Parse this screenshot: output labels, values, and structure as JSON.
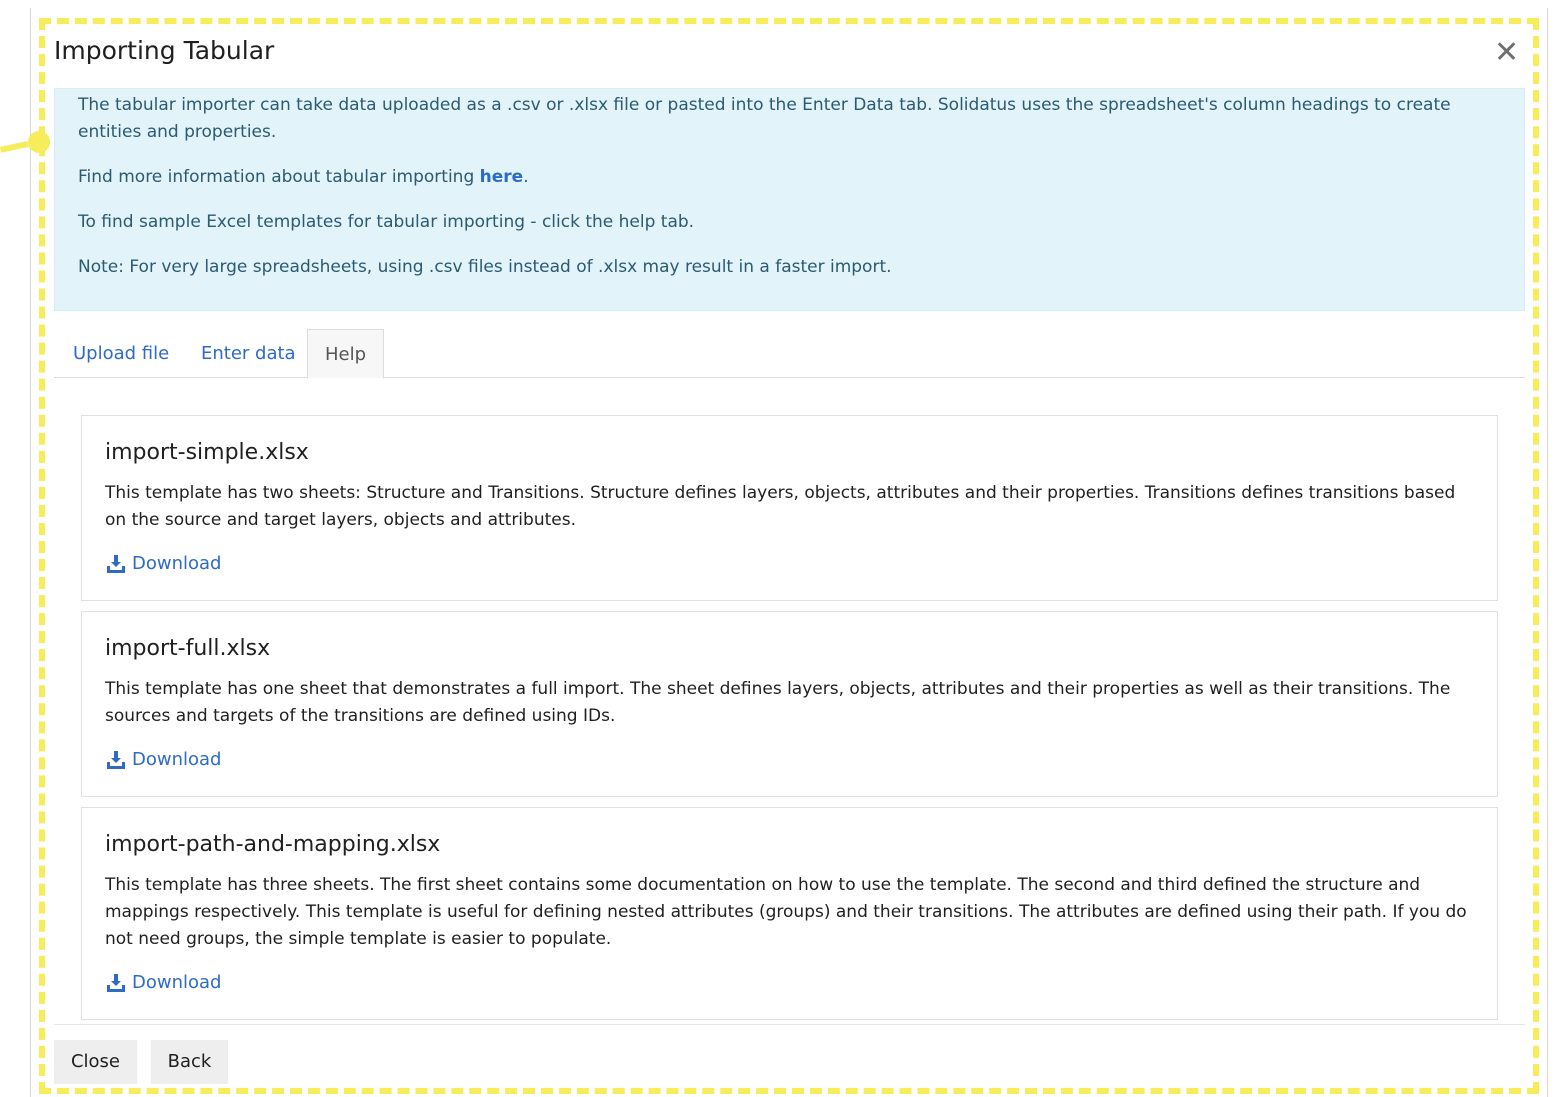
{
  "dialog": {
    "title": "Importing Tabular",
    "close_glyph": "✕"
  },
  "info": {
    "paragraph_1": "The tabular importer can take data uploaded as a .csv or .xlsx file or pasted into the Enter Data tab. Solidatus uses the spreadsheet's column headings to create entities and properties.",
    "paragraph_2_prefix": "Find more information about tabular importing ",
    "paragraph_2_link": "here",
    "paragraph_2_suffix": ".",
    "paragraph_3": "To find sample Excel templates for tabular importing - click the help tab.",
    "paragraph_4": "Note: For very large spreadsheets, using .csv files instead of .xlsx may result in a faster import."
  },
  "tabs": [
    {
      "label": "Upload file",
      "active": false
    },
    {
      "label": "Enter data",
      "active": false
    },
    {
      "label": "Help",
      "active": true
    }
  ],
  "templates": [
    {
      "title": "import-simple.xlsx",
      "description": "This template has two sheets: Structure and Transitions. Structure defines layers, objects, attributes and their properties. Transitions defines transitions based on the source and target layers, objects and attributes.",
      "download_label": "Download"
    },
    {
      "title": "import-full.xlsx",
      "description": "This template has one sheet that demonstrates a full import. The sheet defines layers, objects, attributes and their properties as well as their transitions. The sources and targets of the transitions are defined using IDs.",
      "download_label": "Download"
    },
    {
      "title": "import-path-and-mapping.xlsx",
      "description": "This template has three sheets. The first sheet contains some documentation on how to use the template. The second and third defined the structure and mappings respectively. This template is useful for defining nested attributes (groups) and their transitions. The attributes are defined using their path. If you do not need groups, the simple template is easier to populate.",
      "download_label": "Download"
    }
  ],
  "footer": {
    "close_label": "Close",
    "back_label": "Back"
  },
  "colors": {
    "info_background": "#e2f3fa",
    "info_text": "#2b5a72",
    "link": "#2e6bc6",
    "highlight": "#f7ec5a"
  },
  "icons": {
    "download": "download-icon",
    "close": "close-icon"
  }
}
